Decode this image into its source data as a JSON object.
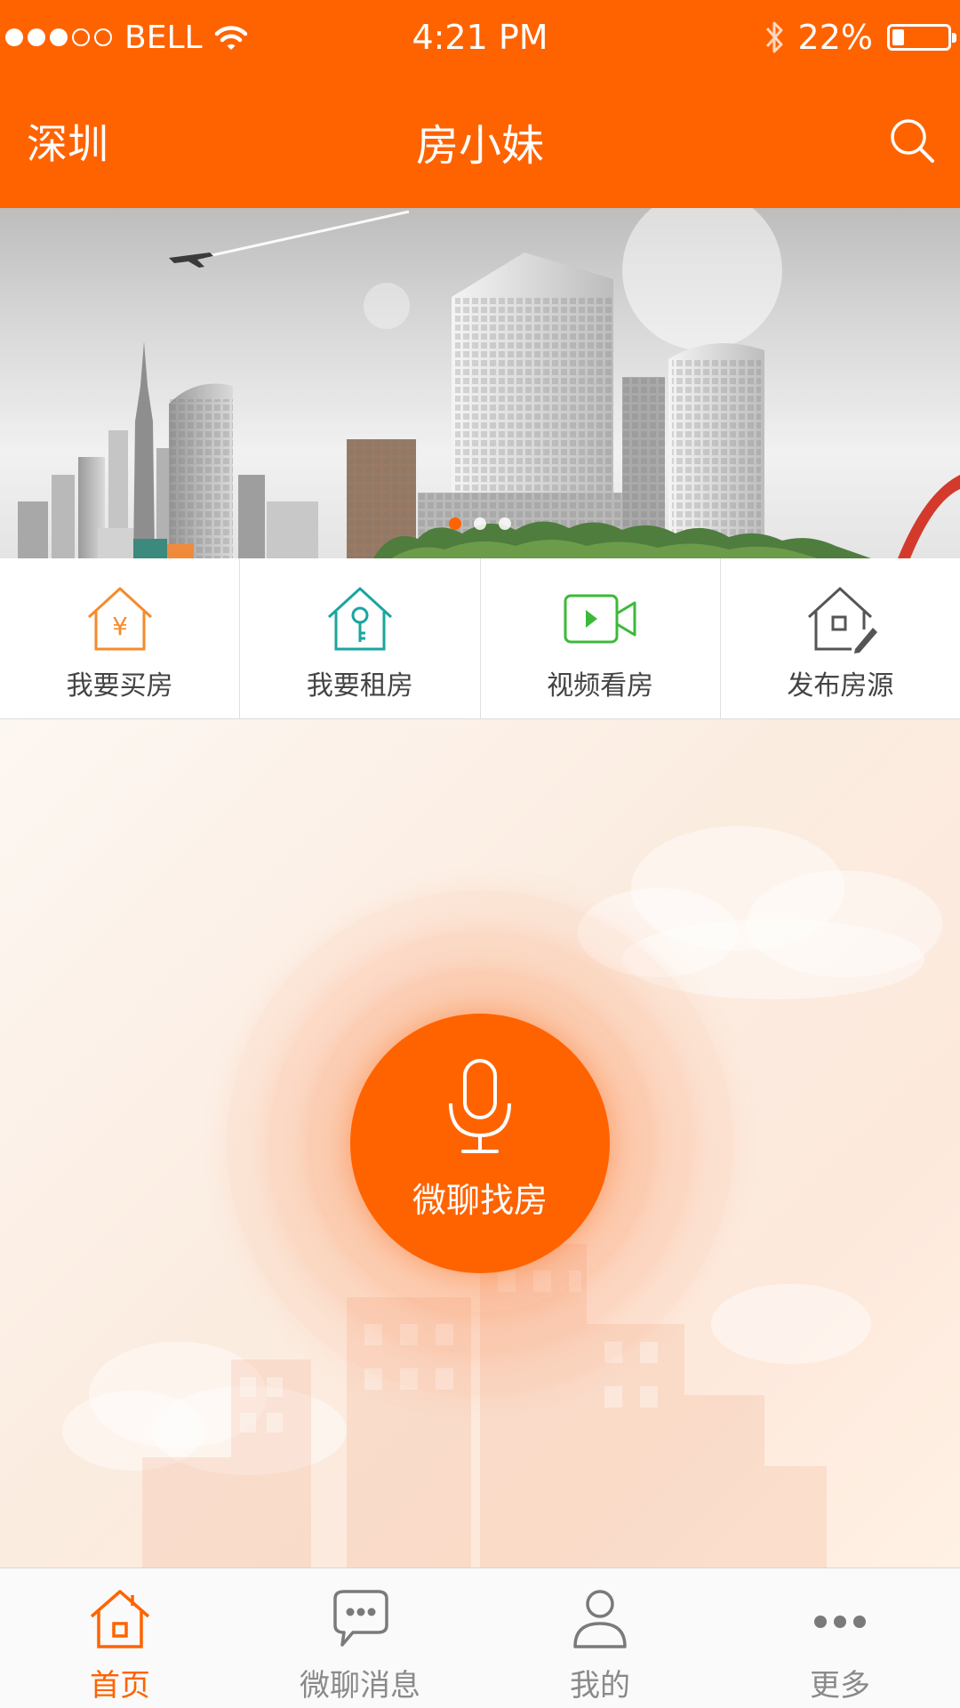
{
  "status_bar": {
    "carrier": "BELL",
    "signal_bars_total": 5,
    "signal_bars_filled": 3,
    "time": "4:21 PM",
    "battery_percent": "22%",
    "battery_level": 0.22
  },
  "nav": {
    "city": "深圳",
    "title": "房小妹",
    "search_icon": "search-icon"
  },
  "banner": {
    "pages": 3,
    "active_page": 1
  },
  "quick_actions": [
    {
      "label": "我要买房",
      "icon": "buy-house-icon",
      "color": "#f58b2b"
    },
    {
      "label": "我要租房",
      "icon": "rent-house-key-icon",
      "color": "#1aa5a0"
    },
    {
      "label": "视频看房",
      "icon": "video-camera-icon",
      "color": "#3cb93a"
    },
    {
      "label": "发布房源",
      "icon": "publish-house-icon",
      "color": "#555555"
    }
  ],
  "voice": {
    "label": "微聊找房",
    "icon": "microphone-icon"
  },
  "tabs": [
    {
      "label": "首页",
      "icon": "home-icon",
      "active": true
    },
    {
      "label": "微聊消息",
      "icon": "chat-bubble-icon",
      "active": false
    },
    {
      "label": "我的",
      "icon": "user-icon",
      "active": false
    },
    {
      "label": "更多",
      "icon": "more-dots-icon",
      "active": false
    }
  ],
  "colors": {
    "brand": "#ff6300",
    "tab_inactive": "#8a8a8a"
  }
}
